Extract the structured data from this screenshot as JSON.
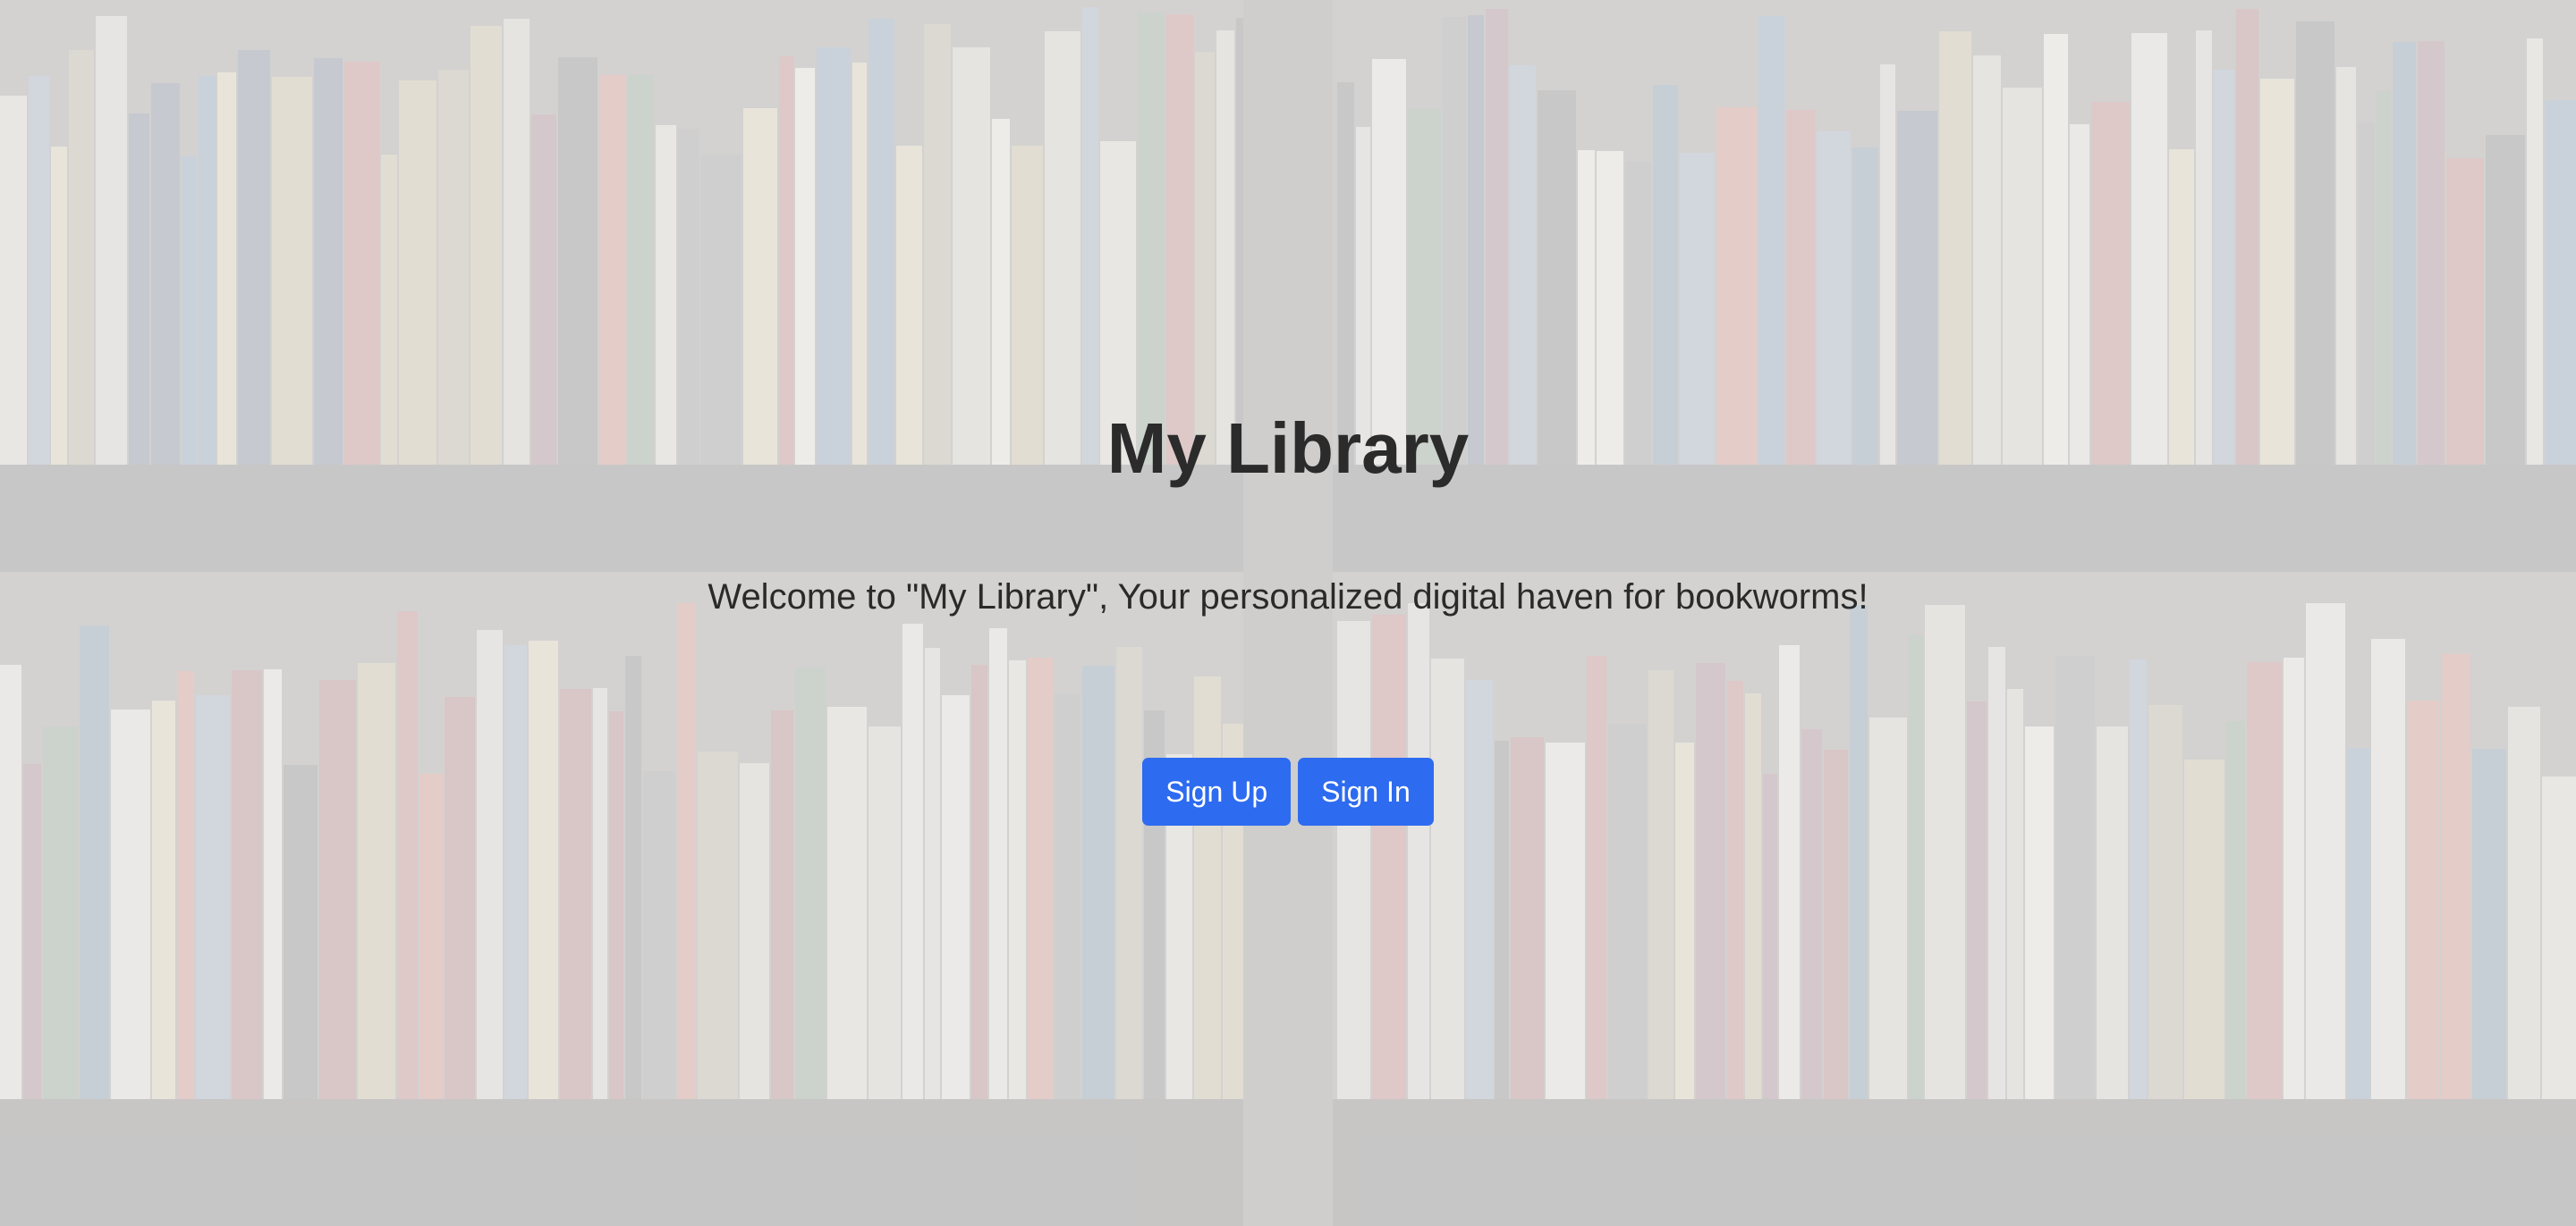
{
  "hero": {
    "title": "My Library",
    "subtitle": "Welcome to \"My Library\", Your personalized digital haven for bookworms!"
  },
  "actions": {
    "sign_up_label": "Sign Up",
    "sign_in_label": "Sign In"
  },
  "colors": {
    "button_bg": "#2d6bf0",
    "button_text": "#ffffff",
    "text": "#2b2b2b",
    "overlay": "#ececec"
  }
}
